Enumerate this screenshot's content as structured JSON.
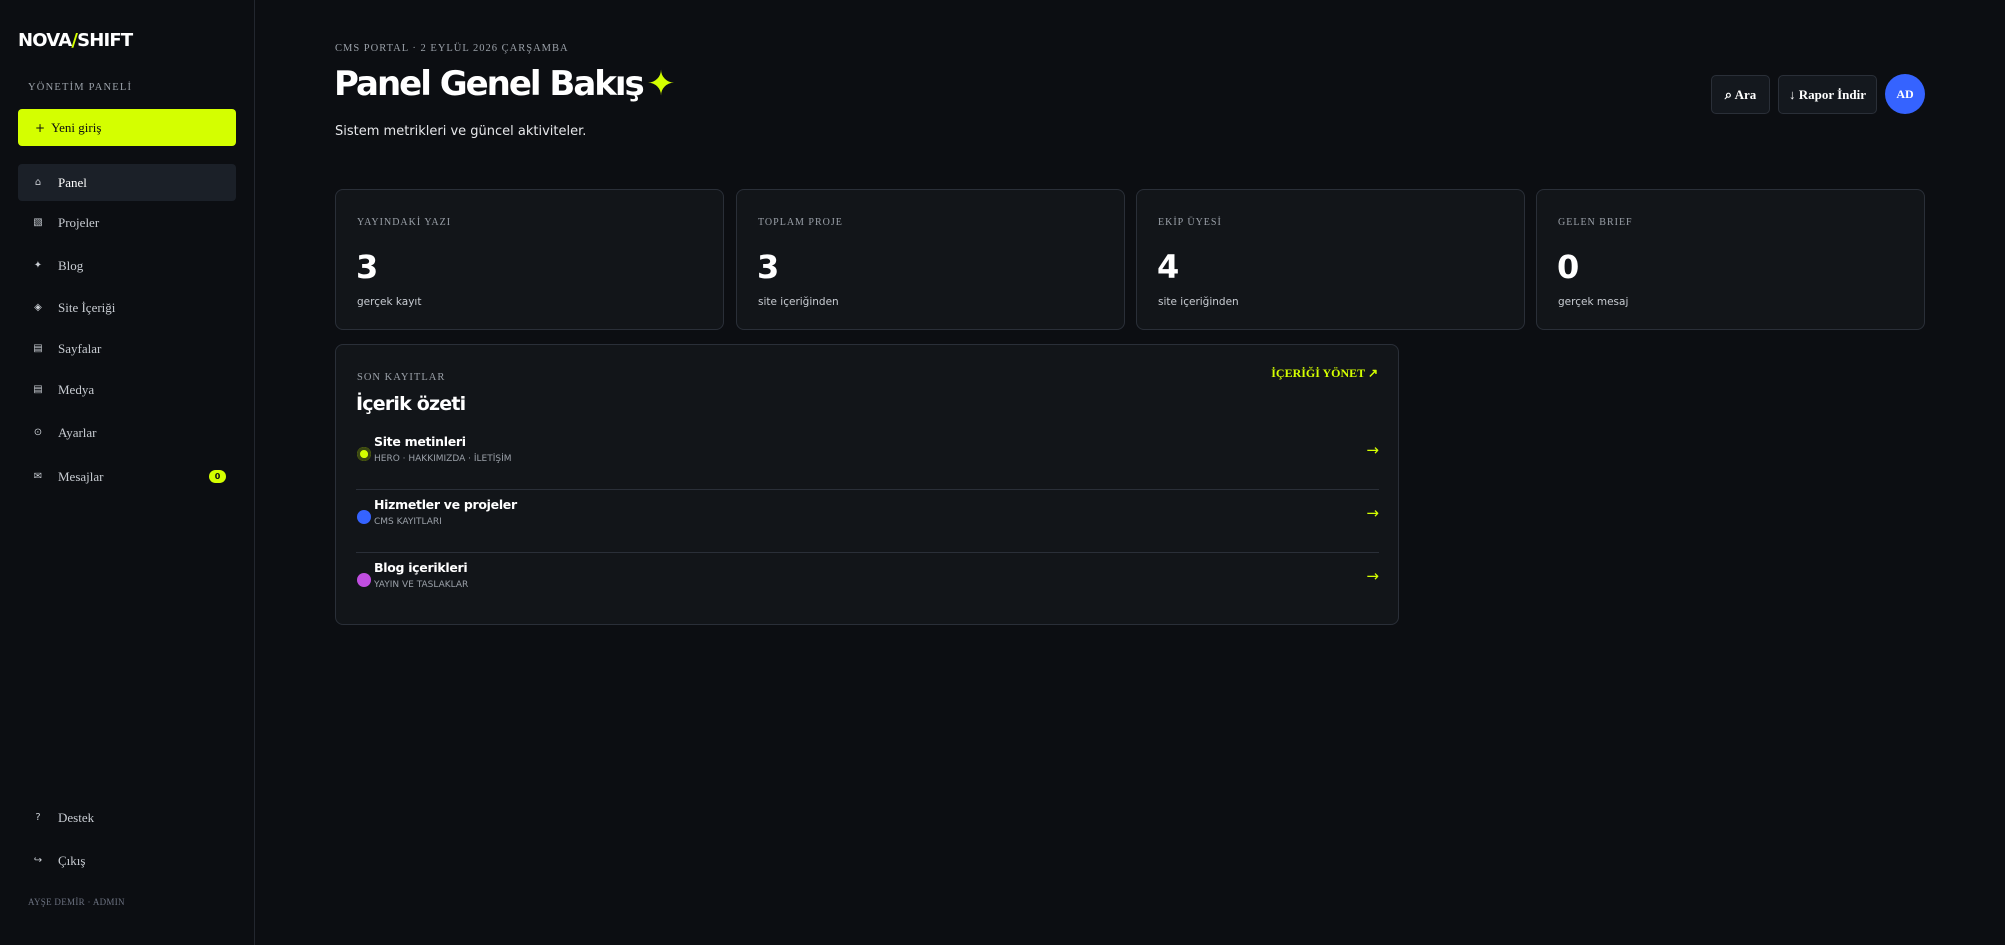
{
  "brand": {
    "logo_part1": "NOVA",
    "logo_slash": "/",
    "logo_part2": "SHIFT"
  },
  "sidebar": {
    "section_label": "YÖNETİM PANELİ",
    "new_entry_label": "Yeni giriş",
    "items": [
      {
        "label": "Panel",
        "icon": "home-icon",
        "glyph": "⌂",
        "active": true
      },
      {
        "label": "Projeler",
        "icon": "grid-icon",
        "glyph": "▧"
      },
      {
        "label": "Blog",
        "icon": "sparkle-icon",
        "glyph": "✦"
      },
      {
        "label": "Site İçeriği",
        "icon": "layers-icon",
        "glyph": "◈"
      },
      {
        "label": "Sayfalar",
        "icon": "pages-icon",
        "glyph": "▤"
      },
      {
        "label": "Medya",
        "icon": "media-icon",
        "glyph": "▤"
      },
      {
        "label": "Ayarlar",
        "icon": "settings-icon",
        "glyph": "⊙"
      },
      {
        "label": "Mesajlar",
        "icon": "mail-icon",
        "glyph": "✉",
        "badge": "0"
      }
    ],
    "bottom_items": [
      {
        "label": "Destek",
        "icon": "help-icon",
        "glyph": "?"
      },
      {
        "label": "Çıkış",
        "icon": "logout-icon",
        "glyph": "↪"
      }
    ],
    "user_footer": "AYŞE DEMİR · ADMIN"
  },
  "header": {
    "breadcrumb": "CMS PORTAL · 2 EYLÜL 2026 ÇARŞAMBA",
    "title": "Panel Genel Bakış",
    "title_spark": "✦",
    "subtitle": "Sistem metrikleri ve güncel aktiviteler.",
    "search_label": "⌕ Ara",
    "download_label": "↓ Rapor İndir",
    "avatar_initials": "AD"
  },
  "stats": [
    {
      "label": "YAYINDAKİ YAZI",
      "value": "3",
      "sub": "gerçek kayıt"
    },
    {
      "label": "TOPLAM PROJE",
      "value": "3",
      "sub": "site içeriğinden"
    },
    {
      "label": "EKİP ÜYESİ",
      "value": "4",
      "sub": "site içeriğinden"
    },
    {
      "label": "GELEN BRIEF",
      "value": "0",
      "sub": "gerçek mesaj"
    }
  ],
  "summary": {
    "eyebrow": "SON KAYITLAR",
    "title": "İçerik özeti",
    "manage_label": "İÇERİĞİ YÖNET ↗",
    "rows": [
      {
        "name": "Site metinleri",
        "meta": "HERO · HAKKIMIZDA · İLETİŞİM",
        "color": "#d4ff00",
        "arrow": "→"
      },
      {
        "name": "Hizmetler ve projeler",
        "meta": "CMS KAYITLARI",
        "color": "#3563ff",
        "arrow": "→"
      },
      {
        "name": "Blog içerikleri",
        "meta": "YAYIN VE TASLAKLAR",
        "color": "#c04ee0",
        "arrow": "→"
      }
    ]
  },
  "colors": {
    "accent": "#d4ff00",
    "blue": "#3563ff",
    "purple": "#c04ee0",
    "background": "#0c0e12",
    "card": "#121519"
  }
}
